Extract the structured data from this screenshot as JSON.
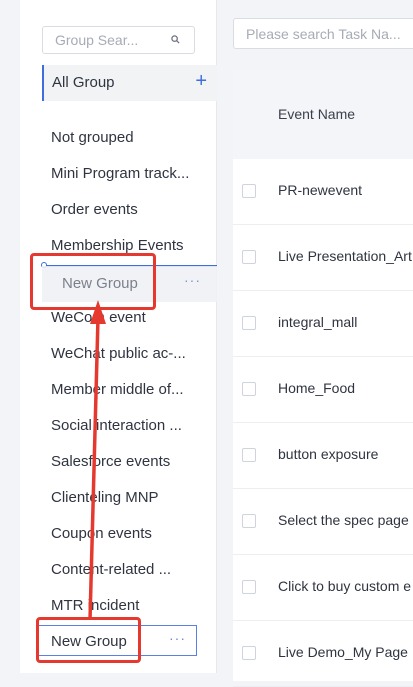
{
  "sidebar": {
    "search_placeholder": "Group Sear...",
    "all_group_label": "All Group",
    "add_symbol": "+",
    "items": [
      "Not grouped",
      "Mini Program track...",
      "Order events",
      "Membership Events",
      "WeCom event",
      "WeChat public ac-...",
      "Member middle of...",
      "Social interaction ...",
      "Salesforce events",
      "Clienteling MNP",
      "Coupon events",
      "Content-related ...",
      "MTR incident"
    ],
    "dragging_label": "New Group",
    "new_group_label": "New Group",
    "more_symbol": "···"
  },
  "main": {
    "search_placeholder": "Please search Task Na...",
    "column_header": "Event Name",
    "rows": [
      "PR-newevent",
      "Live Presentation_Art",
      "integral_mall",
      "Home_Food",
      "button exposure",
      "Select the spec page",
      "Click to buy custom e",
      "Live Demo_My Page"
    ]
  },
  "colors": {
    "accent": "#3f6de0",
    "annotation": "#e5392f"
  }
}
